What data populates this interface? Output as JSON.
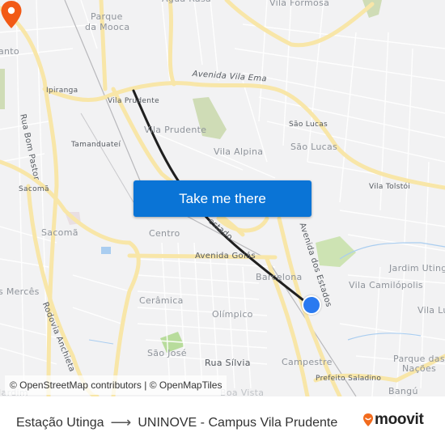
{
  "map": {
    "labels": {
      "agua_rasa": "Água Rasa",
      "vila_formosa": "Vila Formosa",
      "parque_da_mooca_1": "Parque",
      "parque_da_mooca_2": "da Mooca",
      "anto": "anto",
      "ipiranga": "Ipiranga",
      "vila_prudente_station": "Vila Prudente",
      "vila_prudente_district": "Vila Prudente",
      "avenida_vila_ema": "Avenida Vila Ema",
      "sao_lucas_small": "São Lucas",
      "sao_lucas": "São Lucas",
      "rua_bom_pastor": "Rua Bom Pastor",
      "tamanduatei": "Tamanduateí",
      "vila_alpina": "Vila Alpina",
      "vila_tolstoi": "Vila Tolstói",
      "sacoma_small": "Sacomã",
      "sacoma": "Sacomã",
      "centro": "Centro",
      "estado": "estado",
      "avenida_dos_estados": "Avenida dos Estados",
      "avenida_goias": "Avenida Goiás",
      "jardim_utinga": "Jardim Utinga",
      "barcelona": "Barcelona",
      "vila_camilopolis": "Vila Camilópolis",
      "mercês": "s Mercês",
      "ceramica": "Cerâmica",
      "olimpico": "Olímpico",
      "vila_lu": "Vila Lu",
      "rodovia_anchieta": "Rodovia Anchieta",
      "sao_jose": "São José",
      "rua_silvia": "Rua Sílvia",
      "campestre": "Campestre",
      "parque_das_nacoes_1": "Parque das",
      "parque_das_nacoes_2": "Nações",
      "prefeito_saladino": "Prefeito Saladino",
      "boa_vista": "Boa Vista",
      "bangu": "Bangú",
      "jardim": "Jardim"
    },
    "attribution": "© OpenStreetMap contributors | © OpenMapTiles",
    "markers": {
      "origin": {
        "icon": "origin-dot-icon",
        "color": "#2a7af0"
      },
      "destination": {
        "icon": "map-pin-icon",
        "color": "#f25a16"
      }
    },
    "route_color": "#1f1f1f"
  },
  "cta": {
    "label": "Take me there",
    "color": "#0a74d6"
  },
  "footer": {
    "origin": "Estação Utinga",
    "arrow_icon": "arrow-right-icon",
    "destination": "UNINOVE - Campus Vila Prudente",
    "brand": "moovit",
    "brand_color": "#f26b1d"
  }
}
